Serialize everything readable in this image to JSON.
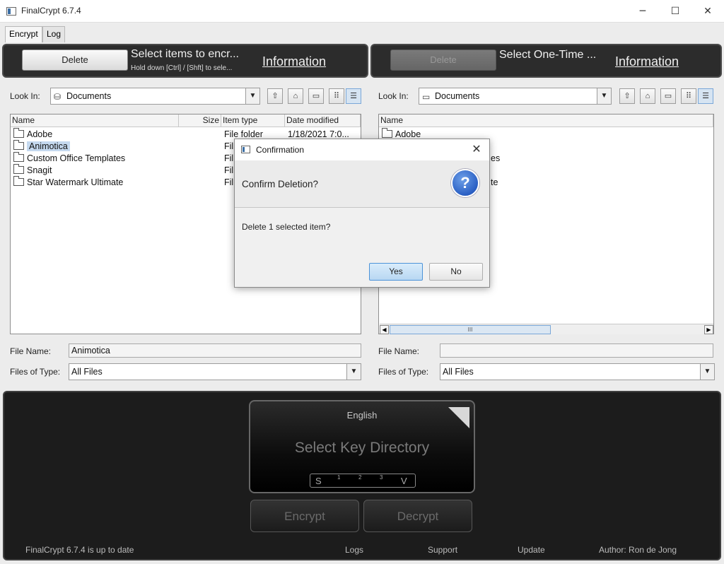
{
  "window": {
    "title": "FinalCrypt 6.7.4",
    "minimize": "─",
    "maximize": "☐",
    "close": "✕"
  },
  "tabs": [
    {
      "label": "Encrypt"
    },
    {
      "label": "Log"
    }
  ],
  "left_panel": {
    "delete_label": "Delete",
    "title": "Select items to encr...",
    "subtitle": "Hold down [Ctrl] / [Shft] to sele...",
    "info_label": "Information",
    "look_in_label": "Look In:",
    "look_in_value": "Documents",
    "columns": [
      "Name",
      "Size",
      "Item type",
      "Date modified"
    ],
    "files": [
      {
        "name": "Adobe",
        "type": "File folder",
        "date": "1/18/2021 7:0..."
      },
      {
        "name": "Animotica",
        "type": "Fil",
        "date": ""
      },
      {
        "name": "Custom Office Templates",
        "type": "Fil",
        "date": ""
      },
      {
        "name": "Snagit",
        "type": "Fil",
        "date": ""
      },
      {
        "name": "Star Watermark Ultimate",
        "type": "Fil",
        "date": ""
      }
    ],
    "file_name_label": "File Name:",
    "file_name_value": "Animotica",
    "files_of_type_label": "Files of Type:",
    "files_of_type_value": "All Files"
  },
  "right_panel": {
    "delete_label": "Delete",
    "title": "Select One-Time ...",
    "info_label": "Information",
    "look_in_label": "Look In:",
    "look_in_value": "Documents",
    "columns": [
      "Name"
    ],
    "files": [
      {
        "name": "Adobe"
      },
      {
        "name": "es"
      },
      {
        "name": "te"
      }
    ],
    "file_name_label": "File Name:",
    "file_name_value": "",
    "files_of_type_label": "Files of Type:",
    "files_of_type_value": "All Files",
    "scroll_thumb": "III"
  },
  "key_panel": {
    "language": "English",
    "title": "Select Key Directory",
    "slider_left": "S",
    "slider_marks": [
      "1",
      "2",
      "3"
    ],
    "slider_right": "V"
  },
  "actions": {
    "encrypt": "Encrypt",
    "decrypt": "Decrypt"
  },
  "footer": {
    "status": "FinalCrypt 6.7.4 is up to date",
    "logs": "Logs",
    "support": "Support",
    "update": "Update",
    "author": "Author: Ron de Jong"
  },
  "dialog": {
    "title": "Confirmation",
    "close": "✕",
    "header": "Confirm Deletion?",
    "icon": "?",
    "message": "Delete 1 selected item?",
    "yes": "Yes",
    "no": "No"
  }
}
